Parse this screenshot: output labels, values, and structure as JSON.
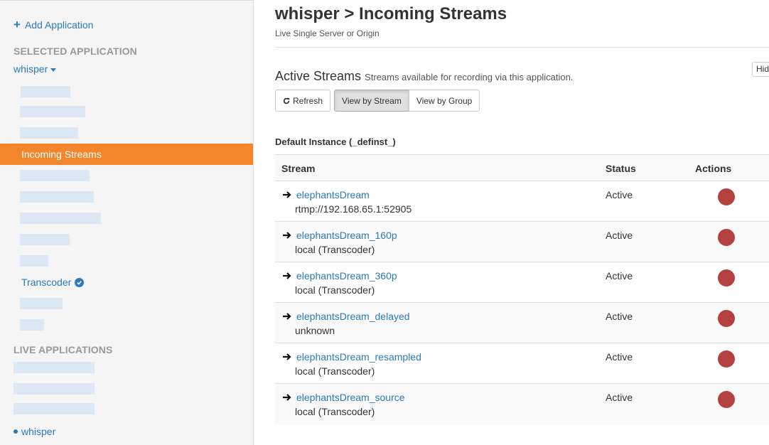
{
  "sidebar": {
    "add_label": "Add Application",
    "selected_heading": "SELECTED APPLICATION",
    "selected_app": "whisper",
    "active_item": "Incoming Streams",
    "transcoder_label": "Transcoder",
    "live_heading": "LIVE APPLICATIONS",
    "live_app": "whisper"
  },
  "header": {
    "title": "whisper > Incoming Streams",
    "subtitle": "Live Single Server or Origin"
  },
  "section": {
    "title": "Active Streams",
    "subtitle": "Streams available for recording via this application.",
    "hide_label": "Hide"
  },
  "buttons": {
    "refresh": "Refresh",
    "by_stream": "View by Stream",
    "by_group": "View by Group"
  },
  "instance_title": "Default Instance (_definst_)",
  "table": {
    "headers": [
      "Stream",
      "Status",
      "Actions"
    ],
    "rows": [
      {
        "name": "elephantsDream",
        "source": "rtmp://192.168.65.1:52905",
        "status": "Active"
      },
      {
        "name": "elephantsDream_160p",
        "source": "local (Transcoder)",
        "status": "Active"
      },
      {
        "name": "elephantsDream_360p",
        "source": "local (Transcoder)",
        "status": "Active"
      },
      {
        "name": "elephantsDream_delayed",
        "source": "unknown",
        "status": "Active"
      },
      {
        "name": "elephantsDream_resampled",
        "source": "local (Transcoder)",
        "status": "Active"
      },
      {
        "name": "elephantsDream_source",
        "source": "local (Transcoder)",
        "status": "Active"
      }
    ]
  },
  "colors": {
    "accent": "#f3862b",
    "link": "#2a7ab7",
    "stop": "#b5413f"
  }
}
